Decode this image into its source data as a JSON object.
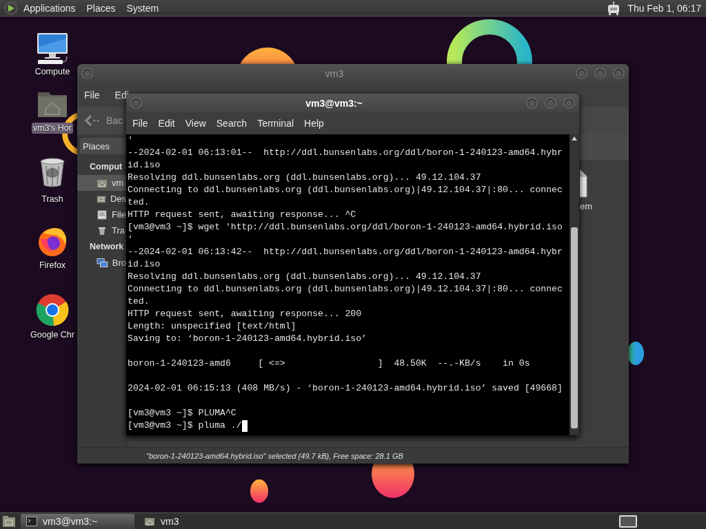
{
  "top_panel": {
    "menus": [
      "Applications",
      "Places",
      "System"
    ],
    "clock": "Thu Feb 1, 06:17"
  },
  "desktop_icons": [
    {
      "kind": "computer",
      "label": "Compute",
      "selected": false
    },
    {
      "kind": "home",
      "label": "vm3's Hor",
      "selected": true
    },
    {
      "kind": "trash",
      "label": "Trash",
      "selected": false
    },
    {
      "kind": "firefox",
      "label": "Firefox",
      "selected": false
    },
    {
      "kind": "chrome",
      "label": "Google Chr",
      "selected": false
    }
  ],
  "file_manager": {
    "title": "vm3",
    "active": false,
    "menus": [
      "File",
      "Edi"
    ],
    "back": "Bac",
    "places_header": "Places",
    "sidebar": [
      {
        "kind": "heading",
        "label": "Comput",
        "selected": false
      },
      {
        "kind": "home",
        "label": "vm",
        "selected": true
      },
      {
        "kind": "desktop",
        "label": "Des",
        "selected": false
      },
      {
        "kind": "filesystem",
        "label": "File",
        "selected": false
      },
      {
        "kind": "trash",
        "label": "Tra",
        "selected": false
      },
      {
        "kind": "heading",
        "label": "Network",
        "selected": false
      },
      {
        "kind": "network",
        "label": "Bro",
        "selected": false
      }
    ],
    "files": [
      {
        "label": "em"
      }
    ],
    "status": "\"boron-1-240123-amd64.hybrid.iso\" selected (49.7 kB), Free space: 28.1 GB"
  },
  "terminal": {
    "title": "vm3@vm3:~",
    "active": true,
    "menus": [
      "File",
      "Edit",
      "View",
      "Search",
      "Terminal",
      "Help"
    ],
    "blocks": [
      [
        "'",
        "--2024-02-01 06:13:01--  http://ddl.bunsenlabs.org/ddl/boron-1-240123-amd64.hybr",
        "id.iso",
        "Resolving ddl.bunsenlabs.org (ddl.bunsenlabs.org)... 49.12.104.37",
        "Connecting to ddl.bunsenlabs.org (ddl.bunsenlabs.org)|49.12.104.37|:80... connec",
        "ted.",
        "HTTP request sent, awaiting response... ^C",
        "[vm3@vm3 ~]$ wget 'http://ddl.bunsenlabs.org/ddl/boron-1-240123-amd64.hybrid.iso",
        "'",
        "--2024-02-01 06:13:42--  http://ddl.bunsenlabs.org/ddl/boron-1-240123-amd64.hybr",
        "id.iso",
        "Resolving ddl.bunsenlabs.org (ddl.bunsenlabs.org)... 49.12.104.37",
        "Connecting to ddl.bunsenlabs.org (ddl.bunsenlabs.org)|49.12.104.37|:80... connec",
        "ted.",
        "HTTP request sent, awaiting response... 200",
        "Length: unspecified [text/html]",
        "Saving to: ‘boron-1-240123-amd64.hybrid.iso’"
      ],
      [
        "boron-1-240123-amd6     [ <=>                 ]  48.50K  --.-KB/s    in 0s"
      ],
      [
        "2024-02-01 06:15:13 (408 MB/s) - ‘boron-1-240123-amd64.hybrid.iso’ saved [49668]"
      ],
      [
        "[vm3@vm3 ~]$ PLUMA^C",
        "[vm3@vm3 ~]$ pluma ./"
      ]
    ]
  },
  "taskbar": {
    "tasks": [
      {
        "kind": "terminal",
        "label": "vm3@vm3:~",
        "selected": true
      },
      {
        "kind": "home",
        "label": "vm3",
        "selected": false
      }
    ]
  }
}
